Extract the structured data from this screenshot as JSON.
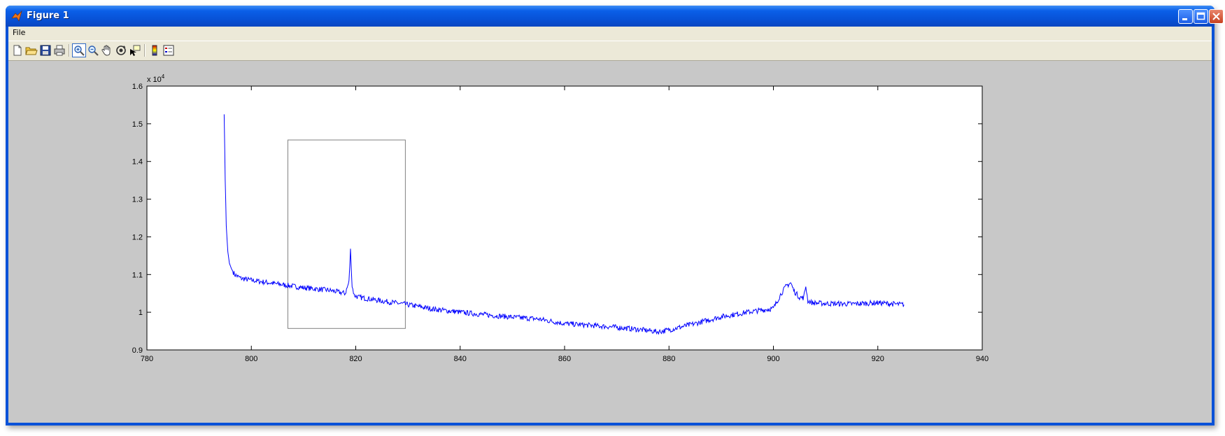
{
  "window": {
    "title": "Figure 1",
    "icon": "matlab-logo-icon"
  },
  "menu": {
    "items": [
      "File"
    ]
  },
  "toolbar": {
    "buttons": [
      {
        "name": "new-figure",
        "icon": "new-file-icon"
      },
      {
        "name": "open-file",
        "icon": "folder-open-icon"
      },
      {
        "name": "save-figure",
        "icon": "floppy-disk-icon"
      },
      {
        "name": "print-figure",
        "icon": "printer-icon"
      },
      {
        "name": "zoom-in",
        "icon": "zoom-in-icon",
        "active": true
      },
      {
        "name": "zoom-out",
        "icon": "zoom-out-icon"
      },
      {
        "name": "pan",
        "icon": "hand-icon"
      },
      {
        "name": "rotate-3d",
        "icon": "rotate-icon"
      },
      {
        "name": "data-cursor",
        "icon": "data-cursor-icon"
      },
      {
        "name": "insert-colorbar",
        "icon": "colorbar-icon"
      },
      {
        "name": "insert-legend",
        "icon": "legend-icon"
      }
    ]
  },
  "colors": {
    "line": "#0000ff",
    "axes_background": "#ffffff",
    "figure_background": "#c8c8c8",
    "zoom_box": "#808080"
  },
  "chart_data": {
    "type": "line",
    "title": "",
    "xlabel": "",
    "ylabel": "",
    "xlim": [
      780,
      940
    ],
    "ylim": [
      9000,
      16000
    ],
    "x_ticks": [
      "780",
      "800",
      "820",
      "840",
      "860",
      "880",
      "900",
      "920",
      "940"
    ],
    "y_ticks": [
      "0.9",
      "1",
      "1.1",
      "1.2",
      "1.3",
      "1.4",
      "1.5",
      "1.6"
    ],
    "y_exponent_label": "x 10",
    "y_exponent_power": "4",
    "grid": false,
    "series": [
      {
        "x": [
          794.8,
          795.0,
          795.2,
          795.5,
          795.8,
          796.2,
          796.8,
          798,
          800,
          805,
          810,
          815,
          818.0,
          818.7,
          819.0,
          819.3,
          819.7,
          820.5,
          825,
          830,
          835,
          840,
          845,
          850,
          855,
          860,
          865,
          870,
          875,
          878,
          880,
          885,
          890,
          895,
          900,
          901.5,
          902.5,
          903.3,
          904,
          905,
          905.8,
          906.2,
          906.6,
          907.5,
          910,
          915,
          920,
          925
        ],
        "y": [
          15250,
          13500,
          12300,
          11600,
          11300,
          11150,
          11000,
          10900,
          10850,
          10750,
          10650,
          10580,
          10500,
          10800,
          11650,
          10700,
          10450,
          10400,
          10300,
          10200,
          10080,
          10000,
          9930,
          9870,
          9820,
          9700,
          9650,
          9600,
          9530,
          9480,
          9530,
          9700,
          9880,
          10000,
          10100,
          10500,
          10700,
          10780,
          10550,
          10400,
          10380,
          10700,
          10300,
          10250,
          10230,
          10220,
          10250,
          10200
        ]
      }
    ],
    "zoom_box": {
      "x": [
        807,
        829.5
      ],
      "y": [
        9570,
        14570
      ]
    }
  }
}
